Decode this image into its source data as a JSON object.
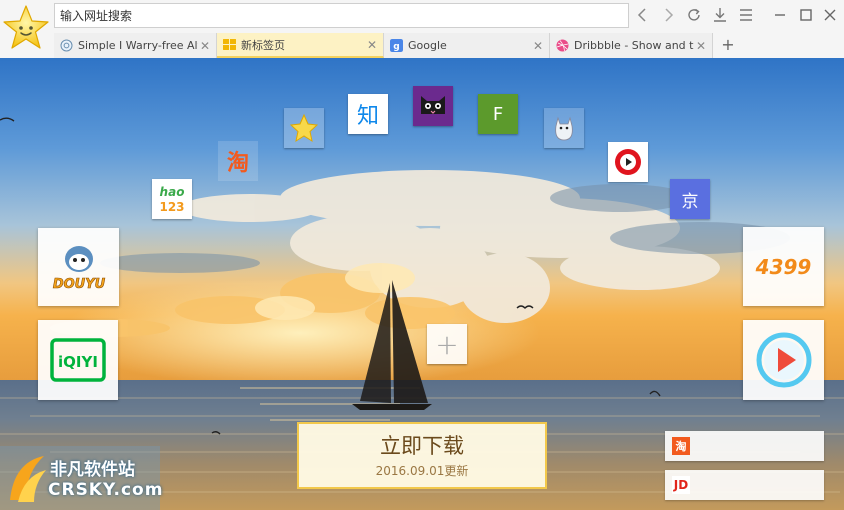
{
  "address_bar": {
    "placeholder": "输入网址搜索"
  },
  "toolbar": {
    "back_icon": "chevron-left-icon",
    "forward_icon": "chevron-right-icon",
    "refresh_icon": "refresh-icon",
    "download_icon": "download-icon",
    "menu_icon": "menu-icon",
    "minimize_icon": "minimize-icon",
    "maximize_icon": "maximize-icon",
    "close_icon": "close-icon"
  },
  "tabs": [
    {
      "title": "Simple I Warry-free Alt",
      "favicon": "globe-icon",
      "active": false
    },
    {
      "title": "新标签页",
      "favicon": "grid-icon",
      "active": true
    },
    {
      "title": "Google",
      "favicon": "google-icon",
      "active": false
    },
    {
      "title": "Dribbble - Show and tel",
      "favicon": "dribbble-icon",
      "active": false
    }
  ],
  "new_tab_label": "+",
  "shortcuts": {
    "zhihu": "知",
    "tmall": "tmall-cat-icon",
    "f_tile": "F",
    "taobao_small": "淘",
    "hao123_top": "hao",
    "hao123_bottom": "123",
    "jd_small": "京",
    "douyu": "DOUYU",
    "iqiyi": "iQIYI",
    "game4399": "4399",
    "add": "+"
  },
  "download_button": {
    "main": "立即下载",
    "sub": "2016.09.01更新"
  },
  "small_links": {
    "taobao": "淘",
    "jd": "JD"
  },
  "watermark": {
    "name": "非凡软件站",
    "site": "CRSKY.com"
  },
  "colors": {
    "accent": "#f2c84b",
    "tab_active": "#fdf2c4",
    "jd": "#5a6fe0",
    "tmall": "#6b2a8e",
    "f_tile": "#5c9a2c",
    "taobao": "#f25a1e",
    "iqiyi": "#00b33c",
    "player": "#55c9f0"
  }
}
